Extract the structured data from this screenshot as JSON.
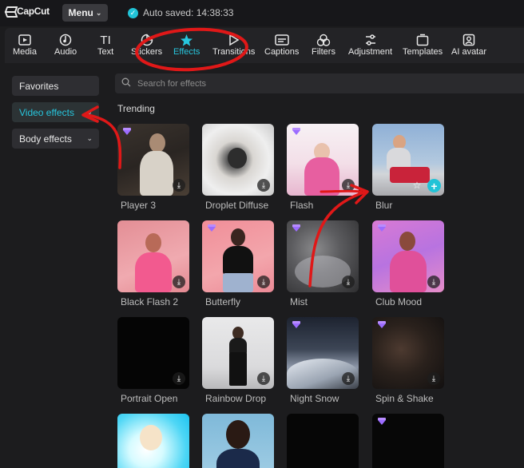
{
  "app": {
    "logo_text": "CapCut",
    "menu_label": "Menu",
    "autosave_text": "Auto saved: 14:38:33"
  },
  "toolbar": {
    "items": [
      {
        "label": "Media",
        "icon": "media-icon"
      },
      {
        "label": "Audio",
        "icon": "audio-icon"
      },
      {
        "label": "Text",
        "icon": "text-icon"
      },
      {
        "label": "Stickers",
        "icon": "stickers-icon"
      },
      {
        "label": "Effects",
        "icon": "effects-icon",
        "active": true
      },
      {
        "label": "Transitions",
        "icon": "transitions-icon"
      },
      {
        "label": "Captions",
        "icon": "captions-icon"
      },
      {
        "label": "Filters",
        "icon": "filters-icon"
      },
      {
        "label": "Adjustment",
        "icon": "adjustment-icon"
      },
      {
        "label": "Templates",
        "icon": "templates-icon"
      },
      {
        "label": "AI avatar",
        "icon": "ai-avatar-icon"
      }
    ]
  },
  "sidebar": {
    "items": [
      {
        "label": "Favorites"
      },
      {
        "label": "Video effects",
        "active": true
      },
      {
        "label": "Body effects"
      }
    ]
  },
  "search": {
    "placeholder": "Search for effects"
  },
  "section_title": "Trending",
  "effects": [
    {
      "name": "Player 3",
      "premium": true
    },
    {
      "name": "Droplet Diffuse",
      "premium": false
    },
    {
      "name": "Flash",
      "premium": true
    },
    {
      "name": "Blur",
      "premium": false
    },
    {
      "name": "Black Flash 2",
      "premium": false
    },
    {
      "name": "Butterfly",
      "premium": true
    },
    {
      "name": "Mist",
      "premium": true
    },
    {
      "name": "Club Mood",
      "premium": true
    },
    {
      "name": "Portrait Open",
      "premium": false
    },
    {
      "name": "Rainbow Drop",
      "premium": false
    },
    {
      "name": "Night Snow",
      "premium": true
    },
    {
      "name": "Spin & Shake",
      "premium": true
    },
    {
      "name": "",
      "premium": false
    },
    {
      "name": "",
      "premium": false
    },
    {
      "name": "",
      "premium": false
    },
    {
      "name": "",
      "premium": true
    }
  ],
  "colors": {
    "accent": "#27c6dd",
    "annotation": "#e01818",
    "premium": "#a97bff"
  }
}
